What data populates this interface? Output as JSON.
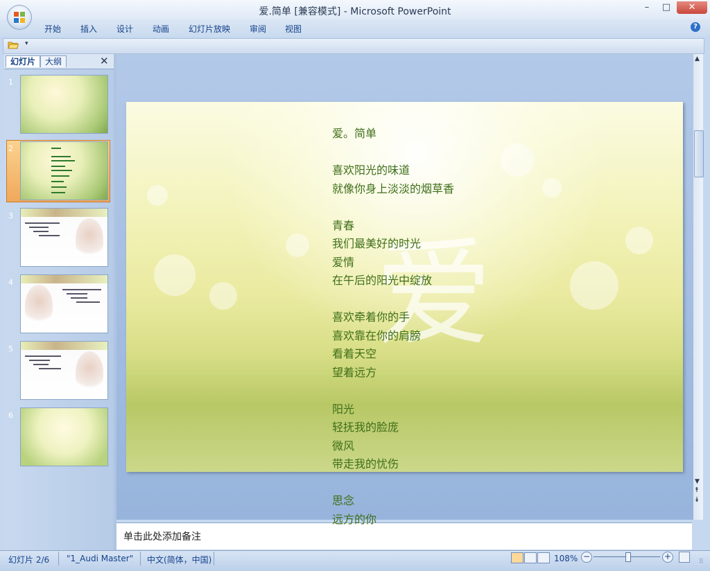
{
  "window": {
    "title": "爱.简单 [兼容模式] - Microsoft PowerPoint",
    "min": "–",
    "max": "□",
    "close": "✕"
  },
  "ribbon": {
    "tabs": [
      "开始",
      "插入",
      "设计",
      "动画",
      "幻灯片放映",
      "审阅",
      "视图"
    ],
    "help": "?"
  },
  "qat": {
    "dropdown": "▾"
  },
  "panel": {
    "tab_slides": "幻灯片",
    "tab_outline": "大纲",
    "close": "✕",
    "slide_numbers": [
      "1",
      "2",
      "3",
      "4",
      "5",
      "6"
    ]
  },
  "slide": {
    "big_char": "爱",
    "poem": "爱。简单\n\n喜欢阳光的味道\n就像你身上淡淡的烟草香\n\n青春\n我们最美好的时光\n爱情\n在午后的阳光中绽放\n\n喜欢牵着你的手\n喜欢靠在你的肩膀\n看着天空\n望着远方\n\n阳光\n轻抚我的脸庞\n微风\n带走我的忧伤\n\n思念\n远方的你"
  },
  "scroll": {
    "up": "▲",
    "down": "▼",
    "prev": "⯭",
    "next": "⯯"
  },
  "notes": {
    "placeholder": "单击此处添加备注"
  },
  "status": {
    "slide": "幻灯片 2/6",
    "theme": "\"1_Audi Master\"",
    "lang": "中文(简体，中国)",
    "zoom": "108%",
    "zoom_out": "−",
    "zoom_in": "+",
    "grip": "⠿"
  },
  "colors": {
    "accent": "#15428b",
    "selection": "#f0a85a",
    "poem_text": "#3f6f18"
  }
}
